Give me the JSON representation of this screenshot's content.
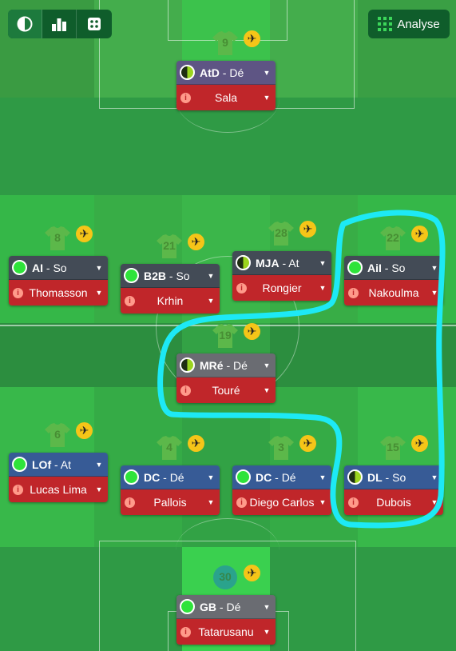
{
  "toolbar": {
    "buttons": [
      {
        "icon": "contrast-icon",
        "active": true
      },
      {
        "icon": "bar-chart-icon",
        "active": false
      },
      {
        "icon": "dice-icon",
        "active": false
      }
    ],
    "analyse_label": "Analyse"
  },
  "players": [
    {
      "id": "p9",
      "shirt": "9",
      "role_abbr": "AtD",
      "role_duty": "Dé",
      "role_color": "def",
      "dot": "half",
      "name": "Sala"
    },
    {
      "id": "p8",
      "shirt": "8",
      "role_abbr": "AI",
      "role_duty": "So",
      "role_color": "sup",
      "dot": "green",
      "name": "Thomasson"
    },
    {
      "id": "p21",
      "shirt": "21",
      "role_abbr": "B2B",
      "role_duty": "So",
      "role_color": "sup",
      "dot": "green",
      "name": "Krhin"
    },
    {
      "id": "p28",
      "shirt": "28",
      "role_abbr": "MJA",
      "role_duty": "At",
      "role_color": "sup",
      "dot": "half",
      "name": "Rongier"
    },
    {
      "id": "p22",
      "shirt": "22",
      "role_abbr": "AiI",
      "role_duty": "So",
      "role_color": "sup",
      "dot": "green",
      "name": "Nakoulma"
    },
    {
      "id": "p19",
      "shirt": "19",
      "role_abbr": "MRé",
      "role_duty": "Dé",
      "role_color": "gray",
      "dot": "half",
      "name": "Touré"
    },
    {
      "id": "p6",
      "shirt": "6",
      "role_abbr": "LOf",
      "role_duty": "At",
      "role_color": "att",
      "dot": "green",
      "name": "Lucas Lima"
    },
    {
      "id": "p4",
      "shirt": "4",
      "role_abbr": "DC",
      "role_duty": "Dé",
      "role_color": "att",
      "dot": "green",
      "name": "Pallois"
    },
    {
      "id": "p3",
      "shirt": "3",
      "role_abbr": "DC",
      "role_duty": "Dé",
      "role_color": "att",
      "dot": "green",
      "name": "Diego Carlos"
    },
    {
      "id": "p15",
      "shirt": "15",
      "role_abbr": "DL",
      "role_duty": "So",
      "role_color": "att",
      "dot": "half",
      "name": "Dubois"
    },
    {
      "id": "p30",
      "shirt": "30",
      "role_abbr": "GB",
      "role_duty": "Dé",
      "role_color": "gray",
      "dot": "green",
      "name": "Tatarusanu"
    }
  ],
  "colors": {
    "pitch_base": "#35a24a",
    "highlight": "#1de9f5",
    "name_bar": "#c0262a"
  }
}
